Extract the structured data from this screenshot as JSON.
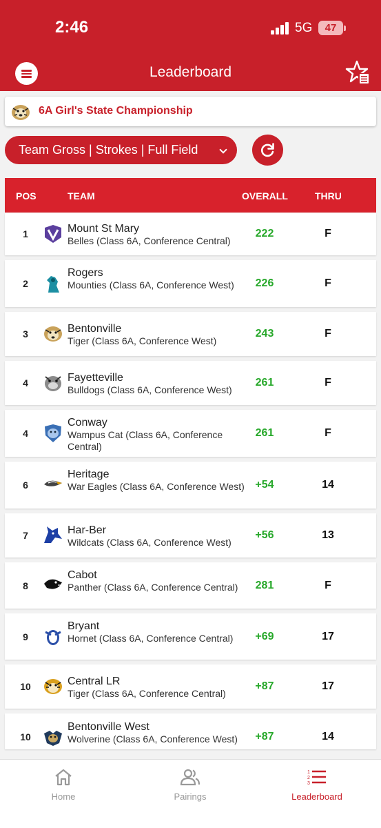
{
  "status_bar": {
    "time": "2:46",
    "network": "5G",
    "battery": "47"
  },
  "header": {
    "title": "Leaderboard"
  },
  "event": {
    "name": "6A Girl's State Championship"
  },
  "filter": {
    "label": "Team Gross | Strokes | Full Field"
  },
  "table": {
    "columns": {
      "pos": "POS",
      "team": "TEAM",
      "overall": "OVERALL",
      "thru": "THRU"
    },
    "rows": [
      {
        "pos": "1",
        "team": "Mount St Mary",
        "desc": "Belles (Class 6A, Conference Central)",
        "overall": "222",
        "thru": "F",
        "logo": "belles-logo"
      },
      {
        "pos": "2",
        "team": "Rogers",
        "desc": "Mounties (Class 6A, Conference West)",
        "overall": "226",
        "thru": "F",
        "logo": "mounties-logo"
      },
      {
        "pos": "3",
        "team": "Bentonville",
        "desc": "Tiger (Class 6A, Conference West)",
        "overall": "243",
        "thru": "F",
        "logo": "tiger-logo"
      },
      {
        "pos": "4",
        "team": "Fayetteville",
        "desc": "Bulldogs (Class 6A, Conference West)",
        "overall": "261",
        "thru": "F",
        "logo": "bulldog-logo"
      },
      {
        "pos": "4",
        "team": "Conway",
        "desc": "Wampus Cat (Class 6A, Conference Central)",
        "overall": "261",
        "thru": "F",
        "logo": "wampus-cat-logo"
      },
      {
        "pos": "6",
        "team": "Heritage",
        "desc": "War Eagles (Class 6A, Conference West)",
        "overall": "+54",
        "thru": "14",
        "logo": "eagle-logo"
      },
      {
        "pos": "7",
        "team": "Har-Ber",
        "desc": "Wildcats (Class 6A, Conference West)",
        "overall": "+56",
        "thru": "13",
        "logo": "wildcat-logo"
      },
      {
        "pos": "8",
        "team": "Cabot",
        "desc": "Panther (Class 6A, Conference Central)",
        "overall": "281",
        "thru": "F",
        "logo": "panther-logo"
      },
      {
        "pos": "9",
        "team": "Bryant",
        "desc": "Hornet (Class 6A, Conference Central)",
        "overall": "+69",
        "thru": "17",
        "logo": "hornet-logo"
      },
      {
        "pos": "10",
        "team": "Central LR",
        "desc": "Tiger (Class 6A, Conference Central)",
        "overall": "+87",
        "thru": "17",
        "logo": "tiger-logo"
      },
      {
        "pos": "10",
        "team": "Bentonville West",
        "desc": "Wolverine (Class 6A, Conference West)",
        "overall": "+87",
        "thru": "14",
        "logo": "wolverine-logo"
      }
    ]
  },
  "nav": {
    "home": "Home",
    "pairings": "Pairings",
    "leaderboard": "Leaderboard"
  },
  "colors": {
    "brand": "#c8202a",
    "score_green": "#27a82a"
  }
}
